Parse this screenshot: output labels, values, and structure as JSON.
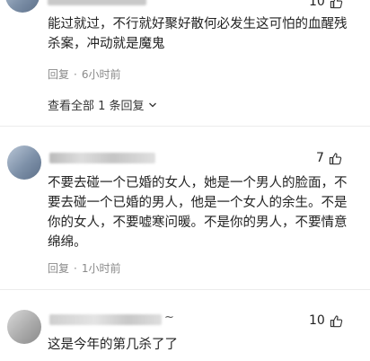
{
  "comments": [
    {
      "likes": "10",
      "text": "能过就过，不行就好聚好散何必发生这可怕的血醒残杀案，冲动就是魔鬼",
      "reply_label": "回复",
      "time": "6小时前",
      "view_all": "查看全部 1 条回复"
    },
    {
      "likes": "7",
      "text": "不要去碰一个已婚的女人，她是一个男人的脸面，不要去碰一个已婚的男人，他是一个女人的余生。不是你的女人，不要嘘寒问暖。不是你的男人，不要情意绵绵。",
      "reply_label": "回复",
      "time": "1小时前"
    },
    {
      "likes": "10",
      "username_suffix": "~",
      "text": "这是今年的第几杀了了"
    }
  ],
  "separator": "·",
  "icons": {
    "like": "thumb-up-icon",
    "expand": "chevron-down-icon"
  }
}
